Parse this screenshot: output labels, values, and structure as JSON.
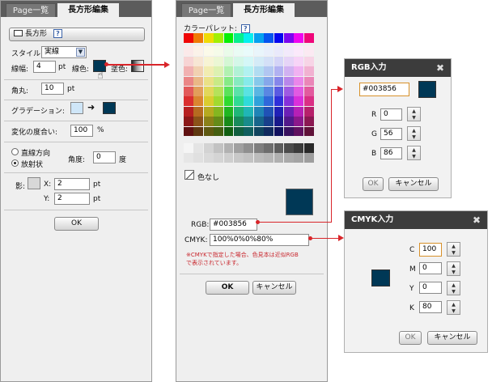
{
  "left_panel": {
    "tabs": [
      "Page一覧",
      "長方形編集"
    ],
    "rect_button": "長方形",
    "help": "?",
    "style_label": "スタイル:",
    "style_value": "実線",
    "linewidth_label": "線幅:",
    "linewidth_value": "4",
    "linewidth_unit": "pt",
    "linecolor_label": "線色:",
    "fillcolor_label": "塗色:",
    "radius_label": "角丸:",
    "radius_value": "10",
    "radius_unit": "pt",
    "gradient_label": "グラデーション:",
    "gradient_from": "#cfe6f8",
    "gradient_to": "#003856",
    "degree_label": "変化の度合い:",
    "degree_value": "100",
    "degree_unit": "%",
    "dir_linear": "直線方向",
    "dir_radial": "放射状",
    "angle_label": "角度:",
    "angle_value": "0",
    "angle_unit": "度",
    "shadow_label": "影:",
    "x_label": "X:",
    "x_value": "2",
    "y_label": "Y:",
    "y_value": "2",
    "pt": "pt",
    "ok": "OK"
  },
  "palette_panel": {
    "tabs": [
      "Page一覧",
      "長方形編集"
    ],
    "title": "カラーパレット:",
    "help": "?",
    "no_color": "色なし",
    "selected_color": "#003856",
    "rgb_label": "RGB:",
    "rgb_value": "#003856",
    "cmyk_label": "CMYK:",
    "cmyk_value": "100%0%0%80%",
    "note_line1": "※CMYKで指定した場合、色見本は近似RGB",
    "note_line2": "で表示されています。",
    "ok": "OK",
    "cancel": "キャンセル"
  },
  "rgb_dialog": {
    "title": "RGB入力",
    "close": "✖",
    "hex": "#003856",
    "r_label": "R",
    "r": "0",
    "g_label": "G",
    "g": "56",
    "b_label": "B",
    "b": "86",
    "ok": "OK",
    "cancel": "キャンセル"
  },
  "cmyk_dialog": {
    "title": "CMYK入力",
    "close": "✖",
    "c_label": "C",
    "c": "100",
    "m_label": "M",
    "m": "0",
    "y_label": "Y",
    "y": "0",
    "k_label": "K",
    "k": "80",
    "ok": "OK",
    "cancel": "キャンセル"
  },
  "colors": {
    "accent": "#d9252a",
    "navy": "#003856"
  }
}
